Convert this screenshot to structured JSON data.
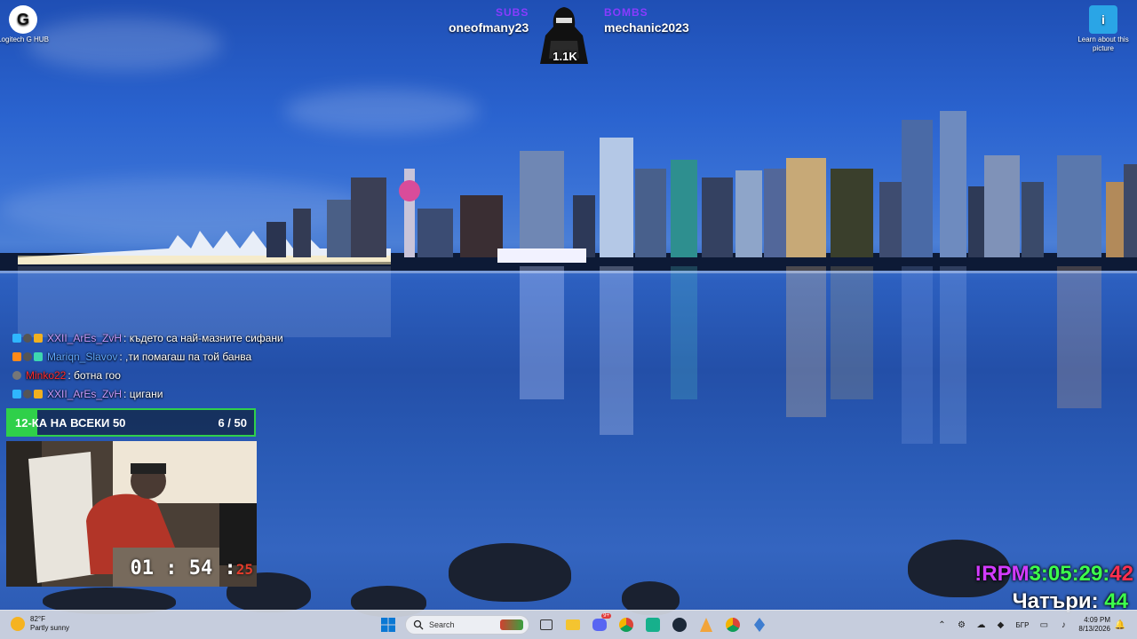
{
  "desktop": {
    "icons": [
      {
        "label": "Logitech G HUB",
        "icon": "logitech-g-icon"
      },
      {
        "label": "Learn about this picture",
        "icon": "learn-picture-icon"
      }
    ]
  },
  "overlay": {
    "subs_tag": "SUBS",
    "subs_name": "oneofmany23",
    "bombs_tag": "BOMBS",
    "bombs_name": "mechanic2023",
    "mascot_count": "1.1K"
  },
  "chat": {
    "messages": [
      {
        "user": "XXII_ArEs_ZvH",
        "text": ": където са най-мазните сифани",
        "user_color": "#c89bff"
      },
      {
        "user": "Mariqn_Slavov",
        "text": ": ,ти помагаш па той банва",
        "user_color": "#5fa8ff"
      },
      {
        "user": "Minko22",
        "text": ": ботна гоо",
        "user_color": "#ff2a2a"
      },
      {
        "user": "XXII_ArEs_ZvH",
        "text": ": цигани",
        "user_color": "#c89bff"
      }
    ]
  },
  "goal": {
    "label": "12-КА НА ВСЕКИ 50",
    "count": "6 / 50",
    "progress": 0.12
  },
  "webcam": {
    "timer_main": "01 : 54 :",
    "timer_sec": "25"
  },
  "stream_stats": {
    "rpm_label": "!RPM",
    "rpm_time": "3:05:29:",
    "rpm_sec": "42",
    "chatters_label": "Чатъри:",
    "chatters_count": "44"
  },
  "taskbar": {
    "weather_temp": "82°F",
    "weather_desc": "Partly sunny",
    "search_placeholder": "Search",
    "language": "БГР",
    "time": "4:09 PM",
    "date": "8/13/2026",
    "discord_badge": "9+"
  }
}
